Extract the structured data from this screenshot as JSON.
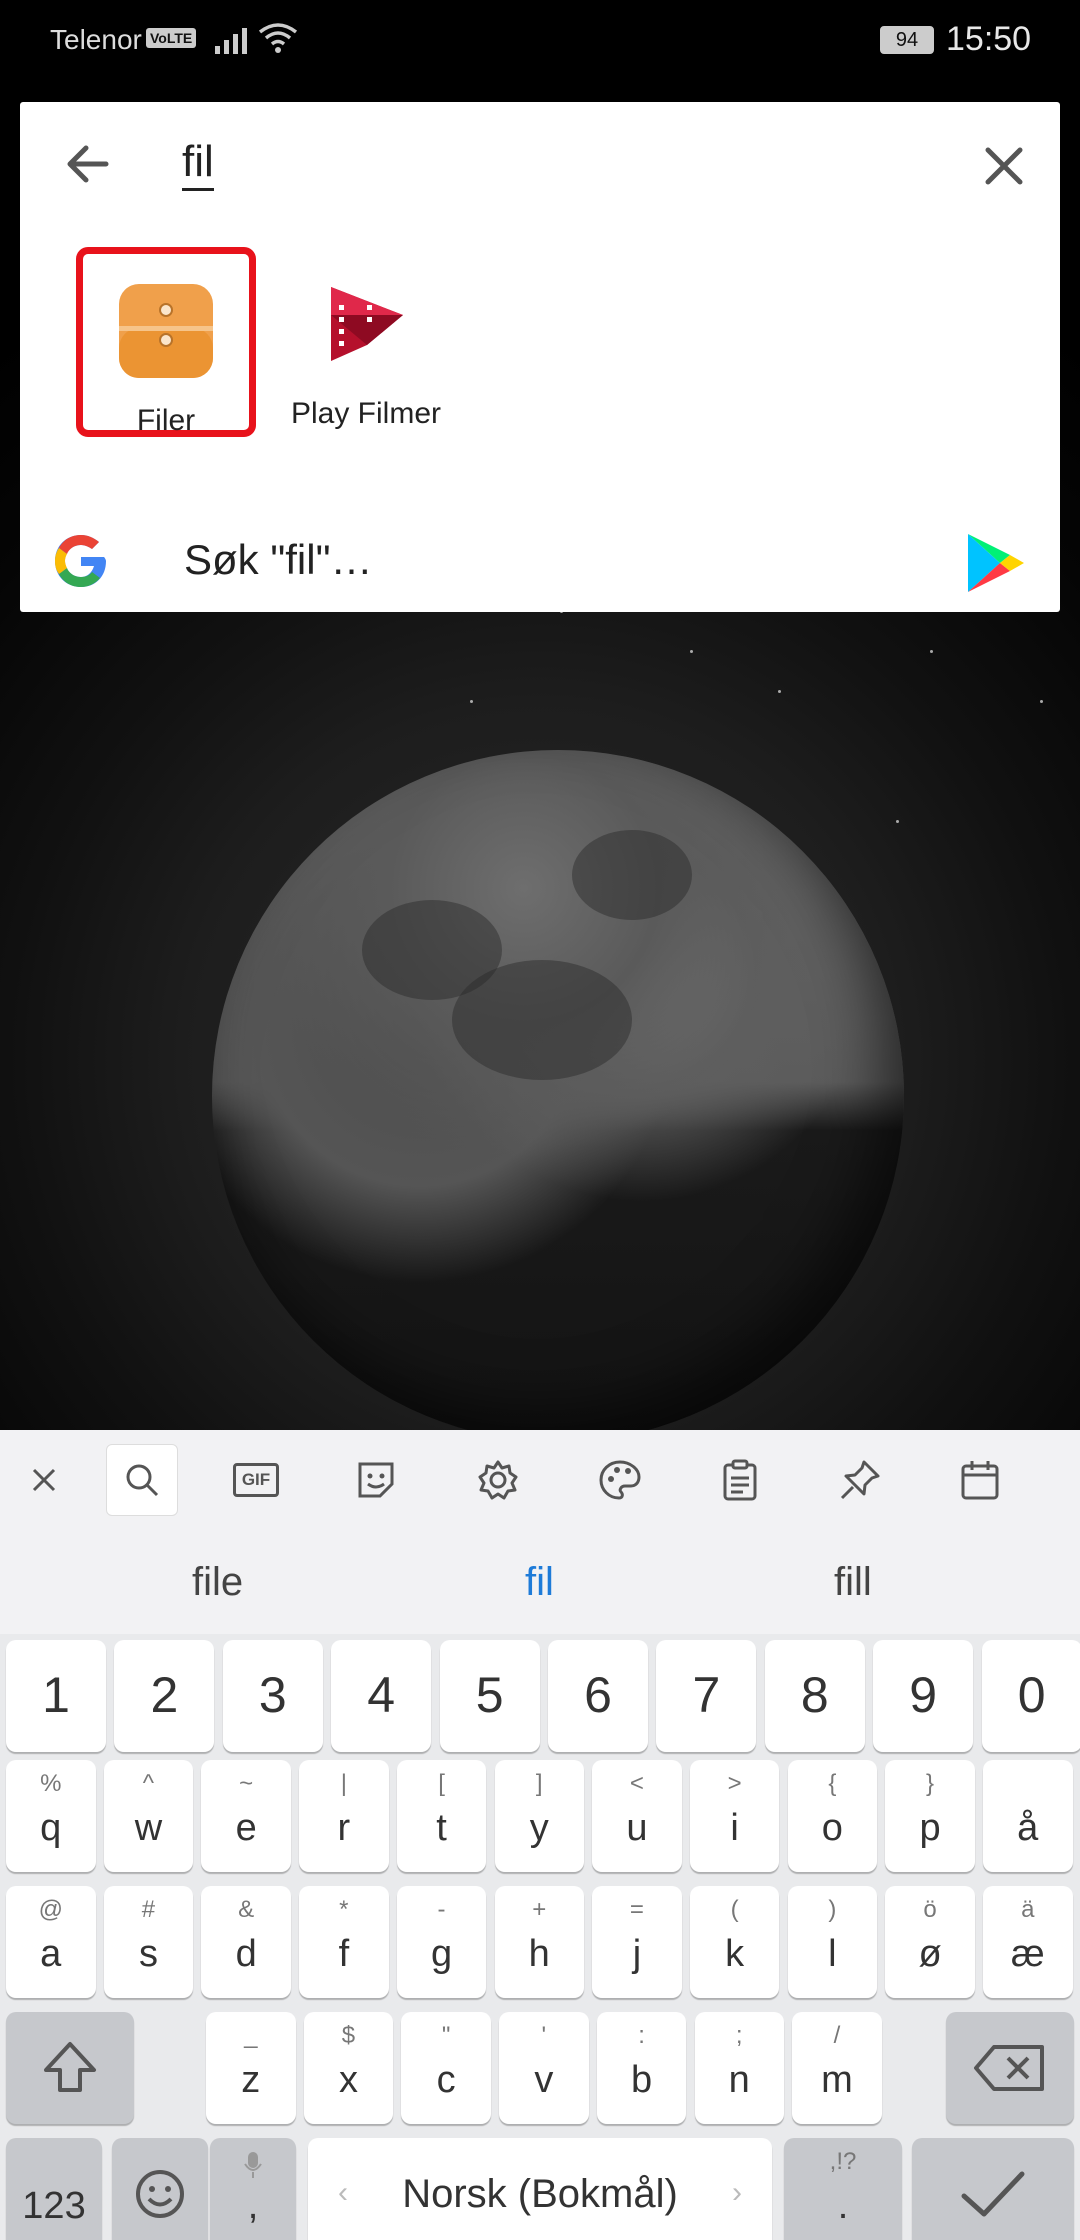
{
  "status_bar": {
    "carrier": "Telenor",
    "volte": "VoLTE",
    "battery": "94",
    "time": "15:50"
  },
  "search": {
    "query": "fil",
    "back_icon": "arrow-left-icon",
    "close_icon": "close-icon",
    "apps": [
      {
        "label": "Filer",
        "icon": "files-folder-icon",
        "highlighted": true
      },
      {
        "label": "Play Filmer",
        "icon": "play-movies-icon",
        "highlighted": false
      }
    ],
    "web_search_label": "Søk \"fil\"…",
    "colors": {
      "highlight": "#e8121b",
      "files_orange": "#f0a04b"
    }
  },
  "keyboard": {
    "toolbar": [
      "close-icon",
      "search-icon",
      "gif-icon",
      "sticker-icon",
      "settings-icon",
      "palette-icon",
      "clipboard-icon",
      "pin-icon",
      "calendar-icon"
    ],
    "gif_label": "GIF",
    "suggestions": [
      "file",
      "fil",
      "fill"
    ],
    "numbers": [
      "1",
      "2",
      "3",
      "4",
      "5",
      "6",
      "7",
      "8",
      "9",
      "0"
    ],
    "row1": [
      {
        "k": "q",
        "a": "%"
      },
      {
        "k": "w",
        "a": "^"
      },
      {
        "k": "e",
        "a": "~"
      },
      {
        "k": "r",
        "a": "|"
      },
      {
        "k": "t",
        "a": "["
      },
      {
        "k": "y",
        "a": "]"
      },
      {
        "k": "u",
        "a": "<"
      },
      {
        "k": "i",
        "a": ">"
      },
      {
        "k": "o",
        "a": "{"
      },
      {
        "k": "p",
        "a": "}"
      },
      {
        "k": "å",
        "a": ""
      }
    ],
    "row2": [
      {
        "k": "a",
        "a": "@"
      },
      {
        "k": "s",
        "a": "#"
      },
      {
        "k": "d",
        "a": "&"
      },
      {
        "k": "f",
        "a": "*"
      },
      {
        "k": "g",
        "a": "-"
      },
      {
        "k": "h",
        "a": "+"
      },
      {
        "k": "j",
        "a": "="
      },
      {
        "k": "k",
        "a": "("
      },
      {
        "k": "l",
        "a": ")"
      },
      {
        "k": "ø",
        "a": "ö"
      },
      {
        "k": "æ",
        "a": "ä"
      }
    ],
    "row3": [
      {
        "k": "z",
        "a": "_"
      },
      {
        "k": "x",
        "a": "$"
      },
      {
        "k": "c",
        "a": "\""
      },
      {
        "k": "v",
        "a": "'"
      },
      {
        "k": "b",
        "a": ":"
      },
      {
        "k": "n",
        "a": ";"
      },
      {
        "k": "m",
        "a": "/"
      }
    ],
    "bottom": {
      "numbers_key": "123",
      "comma_key": ",",
      "space_label": "Norsk (Bokmål)",
      "period_key": ".",
      "period_alt": ",!?"
    }
  }
}
